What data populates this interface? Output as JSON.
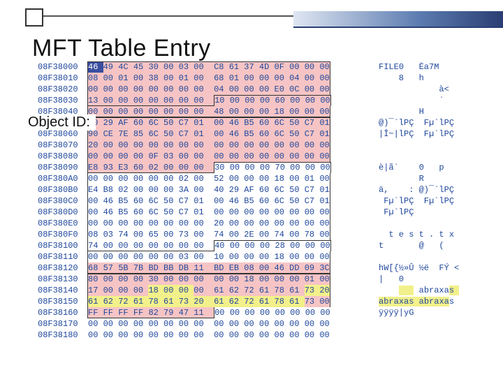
{
  "title": "MFT Table Entry",
  "object_id_label": "Object ID:",
  "grouping": {
    "pink_ranges": [
      [
        0,
        151
      ],
      [
        288,
        359
      ]
    ],
    "yellow_ranges": [
      [
        324,
        326
      ],
      [
        334,
        341
      ],
      [
        342,
        349
      ]
    ],
    "outlines": [
      {
        "start": 0,
        "end": 55
      },
      {
        "start": 56,
        "end": 79
      },
      {
        "start": 80,
        "end": 151
      },
      {
        "start": 152,
        "end": 263
      },
      {
        "start": 264,
        "end": 303
      },
      {
        "start": 304,
        "end": 359
      }
    ]
  },
  "rows": [
    {
      "offset": "08F38000",
      "bytes": [
        "46",
        "49",
        "4C",
        "45",
        "30",
        "00",
        "03",
        "00",
        "C8",
        "61",
        "37",
        "4D",
        "0F",
        "00",
        "00",
        "00"
      ],
      "ascii": "FILE0   Èa7M    ",
      "sel": [
        0
      ]
    },
    {
      "offset": "08F38010",
      "bytes": [
        "08",
        "00",
        "01",
        "00",
        "38",
        "00",
        "01",
        "00",
        "68",
        "01",
        "00",
        "00",
        "00",
        "04",
        "00",
        "00"
      ],
      "ascii": "    8   h       "
    },
    {
      "offset": "08F38020",
      "bytes": [
        "00",
        "00",
        "00",
        "00",
        "00",
        "00",
        "00",
        "00",
        "04",
        "00",
        "00",
        "00",
        "E0",
        "0C",
        "00",
        "00"
      ],
      "ascii": "            à<  "
    },
    {
      "offset": "08F38030",
      "bytes": [
        "13",
        "00",
        "00",
        "00",
        "00",
        "00",
        "00",
        "00",
        "10",
        "00",
        "00",
        "00",
        "60",
        "00",
        "00",
        "00"
      ],
      "ascii": "            `   "
    },
    {
      "offset": "08F38040",
      "bytes": [
        "00",
        "00",
        "00",
        "00",
        "00",
        "00",
        "00",
        "00",
        "48",
        "00",
        "00",
        "00",
        "18",
        "00",
        "00",
        "00"
      ],
      "ascii": "        H       "
    },
    {
      "offset": "08F38050",
      "bytes": [
        "40",
        "29",
        "AF",
        "60",
        "6C",
        "50",
        "C7",
        "01",
        "00",
        "46",
        "B5",
        "60",
        "6C",
        "50",
        "C7",
        "01"
      ],
      "ascii": "@)¯`lPÇ  Fµ`lPÇ "
    },
    {
      "offset": "08F38060",
      "bytes": [
        "90",
        "CE",
        "7E",
        "85",
        "6C",
        "50",
        "C7",
        "01",
        "00",
        "46",
        "B5",
        "60",
        "6C",
        "50",
        "C7",
        "01"
      ],
      "ascii": "|Î~|lPÇ  Fµ`lPÇ "
    },
    {
      "offset": "08F38070",
      "bytes": [
        "20",
        "00",
        "00",
        "00",
        "00",
        "00",
        "00",
        "00",
        "00",
        "00",
        "00",
        "00",
        "00",
        "00",
        "00",
        "00"
      ],
      "ascii": "                "
    },
    {
      "offset": "08F38080",
      "bytes": [
        "00",
        "00",
        "00",
        "00",
        "0F",
        "03",
        "00",
        "00",
        "00",
        "00",
        "00",
        "00",
        "00",
        "00",
        "00",
        "00"
      ],
      "ascii": "                "
    },
    {
      "offset": "08F38090",
      "bytes": [
        "E8",
        "93",
        "E3",
        "60",
        "02",
        "00",
        "00",
        "00",
        "30",
        "00",
        "00",
        "00",
        "70",
        "00",
        "00",
        "00"
      ],
      "ascii": "è|ã`    0   p   "
    },
    {
      "offset": "08F380A0",
      "bytes": [
        "00",
        "00",
        "00",
        "00",
        "00",
        "00",
        "02",
        "00",
        "52",
        "00",
        "00",
        "00",
        "18",
        "00",
        "01",
        "00"
      ],
      "ascii": "        R       "
    },
    {
      "offset": "08F380B0",
      "bytes": [
        "E4",
        "B8",
        "02",
        "00",
        "00",
        "00",
        "3A",
        "00",
        "40",
        "29",
        "AF",
        "60",
        "6C",
        "50",
        "C7",
        "01"
      ],
      "ascii": "ä,    : @)¯`lPÇ "
    },
    {
      "offset": "08F380C0",
      "bytes": [
        "00",
        "46",
        "B5",
        "60",
        "6C",
        "50",
        "C7",
        "01",
        "00",
        "46",
        "B5",
        "60",
        "6C",
        "50",
        "C7",
        "01"
      ],
      "ascii": " Fµ`lPÇ  Fµ`lPÇ "
    },
    {
      "offset": "08F380D0",
      "bytes": [
        "00",
        "46",
        "B5",
        "60",
        "6C",
        "50",
        "C7",
        "01",
        "00",
        "00",
        "00",
        "00",
        "00",
        "00",
        "00",
        "00"
      ],
      "ascii": " Fµ`lPÇ         "
    },
    {
      "offset": "08F380E0",
      "bytes": [
        "00",
        "00",
        "00",
        "00",
        "00",
        "00",
        "00",
        "00",
        "20",
        "00",
        "00",
        "00",
        "00",
        "00",
        "00",
        "00"
      ],
      "ascii": "                "
    },
    {
      "offset": "08F380F0",
      "bytes": [
        "08",
        "03",
        "74",
        "00",
        "65",
        "00",
        "73",
        "00",
        "74",
        "00",
        "2E",
        "00",
        "74",
        "00",
        "78",
        "00"
      ],
      "ascii": "  t e s t . t x "
    },
    {
      "offset": "08F38100",
      "bytes": [
        "74",
        "00",
        "00",
        "00",
        "00",
        "00",
        "00",
        "00",
        "40",
        "00",
        "00",
        "00",
        "28",
        "00",
        "00",
        "00"
      ],
      "ascii": "t       @   (   "
    },
    {
      "offset": "08F38110",
      "bytes": [
        "00",
        "00",
        "00",
        "00",
        "00",
        "00",
        "03",
        "00",
        "10",
        "00",
        "00",
        "00",
        "18",
        "00",
        "00",
        "00"
      ],
      "ascii": "                "
    },
    {
      "offset": "08F38120",
      "bytes": [
        "68",
        "57",
        "5B",
        "7B",
        "BD",
        "BB",
        "DB",
        "11",
        "BD",
        "EB",
        "08",
        "00",
        "46",
        "DD",
        "09",
        "3C"
      ],
      "ascii": "hW[{½»Û ½ë  FÝ <"
    },
    {
      "offset": "08F38130",
      "bytes": [
        "80",
        "00",
        "00",
        "00",
        "30",
        "00",
        "00",
        "00",
        "00",
        "00",
        "18",
        "00",
        "00",
        "00",
        "01",
        "00"
      ],
      "ascii": "|   0           "
    },
    {
      "offset": "08F38140",
      "bytes": [
        "17",
        "00",
        "00",
        "00",
        "18",
        "00",
        "00",
        "00",
        "61",
        "62",
        "72",
        "61",
        "78",
        "61",
        "73",
        "20"
      ],
      "ascii": "        abraxas "
    },
    {
      "offset": "08F38150",
      "bytes": [
        "61",
        "62",
        "72",
        "61",
        "78",
        "61",
        "73",
        "20",
        "61",
        "62",
        "72",
        "61",
        "78",
        "61",
        "73",
        "00"
      ],
      "ascii": "abraxas abraxas "
    },
    {
      "offset": "08F38160",
      "bytes": [
        "FF",
        "FF",
        "FF",
        "FF",
        "82",
        "79",
        "47",
        "11",
        "00",
        "00",
        "00",
        "00",
        "00",
        "00",
        "00",
        "00"
      ],
      "ascii": "ÿÿÿÿ|yG         "
    },
    {
      "offset": "08F38170",
      "bytes": [
        "00",
        "00",
        "00",
        "00",
        "00",
        "00",
        "00",
        "00",
        "00",
        "00",
        "00",
        "00",
        "00",
        "00",
        "00",
        "00"
      ],
      "ascii": "                "
    },
    {
      "offset": "08F38180",
      "bytes": [
        "00",
        "00",
        "00",
        "00",
        "00",
        "00",
        "00",
        "00",
        "00",
        "00",
        "00",
        "00",
        "00",
        "00",
        "00",
        "00"
      ],
      "ascii": "                "
    }
  ]
}
